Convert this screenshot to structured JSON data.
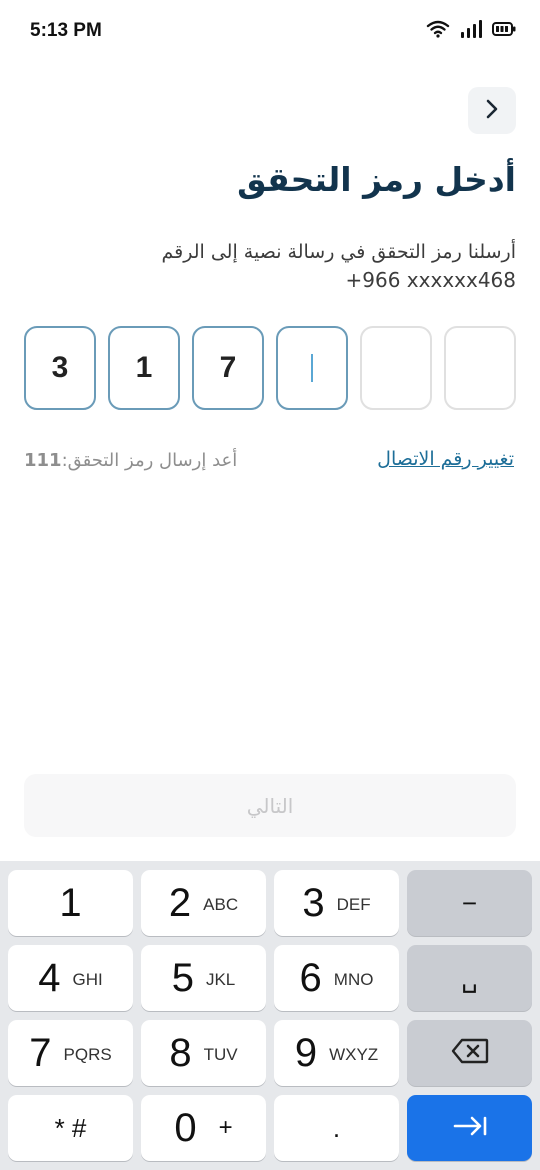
{
  "status_bar": {
    "time": "5:13 PM",
    "icons": [
      "wifi-icon",
      "signal-icon",
      "battery-icon"
    ]
  },
  "header": {
    "back_icon": "chevron-right-icon",
    "title": "أدخل رمز التحقق"
  },
  "subtitle": {
    "text": "أرسلنا رمز التحقق في رسالة نصية إلى الرقم",
    "phone": "+966 xxxxxx468"
  },
  "otp": {
    "digits": [
      "3",
      "1",
      "7",
      "",
      "",
      ""
    ],
    "active_index": 3
  },
  "links": {
    "change_number": "تغيير رقم الاتصال",
    "resend_label": "أعد إرسال رمز التحقق:",
    "resend_countdown": "111"
  },
  "next_button": {
    "label": "التالي",
    "enabled": false
  },
  "keyboard": {
    "keys": [
      {
        "main": "1",
        "sub": ""
      },
      {
        "main": "2",
        "sub": "ABC"
      },
      {
        "main": "3",
        "sub": "DEF"
      },
      {
        "main": "−",
        "sub": ""
      },
      {
        "main": "4",
        "sub": "GHI"
      },
      {
        "main": "5",
        "sub": "JKL"
      },
      {
        "main": "6",
        "sub": "MNO"
      },
      {
        "main": "␣",
        "sub": ""
      },
      {
        "main": "7",
        "sub": "PQRS"
      },
      {
        "main": "8",
        "sub": "TUV"
      },
      {
        "main": "9",
        "sub": "WXYZ"
      },
      {
        "main": "backspace-icon",
        "sub": ""
      },
      {
        "main": "* #",
        "sub": ""
      },
      {
        "main": "0",
        "sub": "+"
      },
      {
        "main": ".",
        "sub": ""
      },
      {
        "main": "next-arrow-icon",
        "sub": ""
      }
    ],
    "colors": {
      "background": "#e6e8eb",
      "key": "#ffffff",
      "function_key": "#c9ccd2",
      "action_key": "#1a73e8"
    }
  },
  "colors": {
    "title": "#12344d",
    "link": "#1d6e98",
    "otp_border_active": "#6a9bb8",
    "otp_border_empty": "#e0e0e0",
    "muted": "#8e8e8e"
  }
}
